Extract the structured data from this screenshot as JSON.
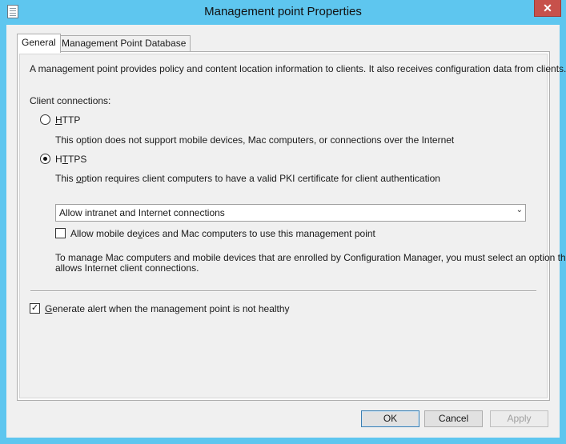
{
  "window": {
    "title": "Management point Properties",
    "close_glyph": "✕"
  },
  "tabs": [
    {
      "label": "General",
      "active": true
    },
    {
      "label": "Management Point Database",
      "active": false
    }
  ],
  "general": {
    "description": "A management point provides policy and content location information to clients.  It also receives configuration data from clients.",
    "client_connections_label": "Client connections:",
    "http": {
      "label_hot": "H",
      "label_rest": "TTP",
      "selected": false,
      "note": "This option does not support mobile devices, Mac computers, or connections over the Internet"
    },
    "https": {
      "label_pre": "H",
      "label_hot": "T",
      "label_rest": "TPS",
      "selected": true,
      "note_pre": "This ",
      "note_hot": "o",
      "note_rest": "ption requires client computers to have a valid PKI certificate for client authentication"
    },
    "connection_select": {
      "value": "Allow intranet and Internet connections",
      "arrow_glyph": "⌄"
    },
    "mobile_checkbox": {
      "label_pre": "Allow mobile de",
      "label_hot": "v",
      "label_rest": "ices and Mac computers to use this management point",
      "checked": false
    },
    "mac_note_line1": "To manage Mac computers and mobile devices that are enrolled by Configuration Manager, you must select an option that",
    "mac_note_line2": "allows Internet client connections.",
    "alert_checkbox": {
      "label_hot": "G",
      "label_rest": "enerate alert when the management point is not healthy",
      "checked": true,
      "check_glyph": "✓"
    }
  },
  "buttons": {
    "ok": "OK",
    "cancel": "Cancel",
    "apply": "Apply"
  }
}
